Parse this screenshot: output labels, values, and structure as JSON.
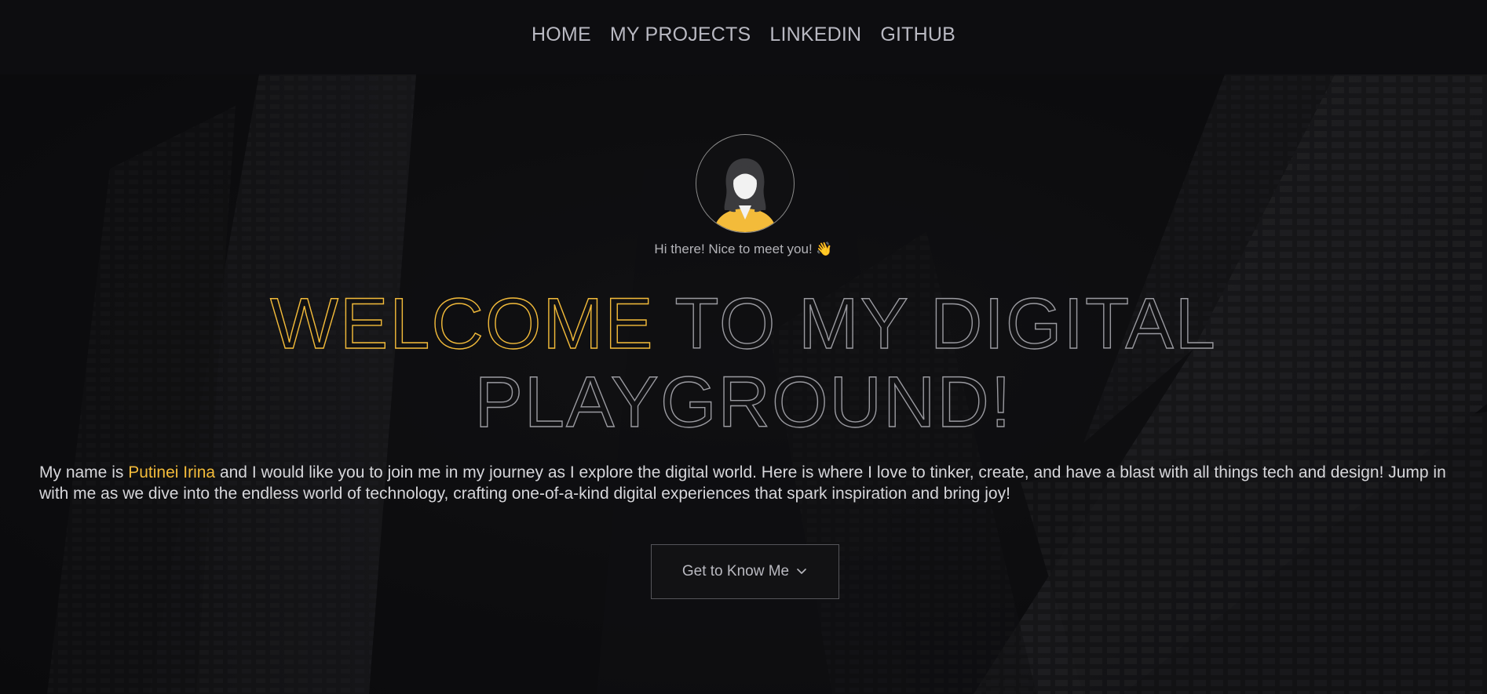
{
  "nav": {
    "items": [
      {
        "label": "HOME"
      },
      {
        "label": "MY PROJECTS"
      },
      {
        "label": "LINKEDIN"
      },
      {
        "label": "GITHUB"
      }
    ]
  },
  "hero": {
    "greeting": "Hi there! Nice to meet you! 👋",
    "headline": {
      "highlight": "WELCOME",
      "rest_line1": " TO MY DIGITAL",
      "line2": "PLAYGROUND!"
    },
    "intro": {
      "prefix": "My name is ",
      "name": "Putinei Irina",
      "suffix": " and I would like you to join me in my journey as I explore the digital world. Here is where I love to tinker, create, and have a blast with all things tech and design! Jump in with me as we dive into the endless world of technology, crafting one-of-a-kind digital experiences that spark inspiration and bring joy!"
    },
    "cta_label": "Get to Know Me",
    "cta_icon": "chevron-down-icon"
  },
  "colors": {
    "accent": "#f3bb3a",
    "background": "#0c0c0e",
    "text_muted": "#b9b9c2"
  }
}
